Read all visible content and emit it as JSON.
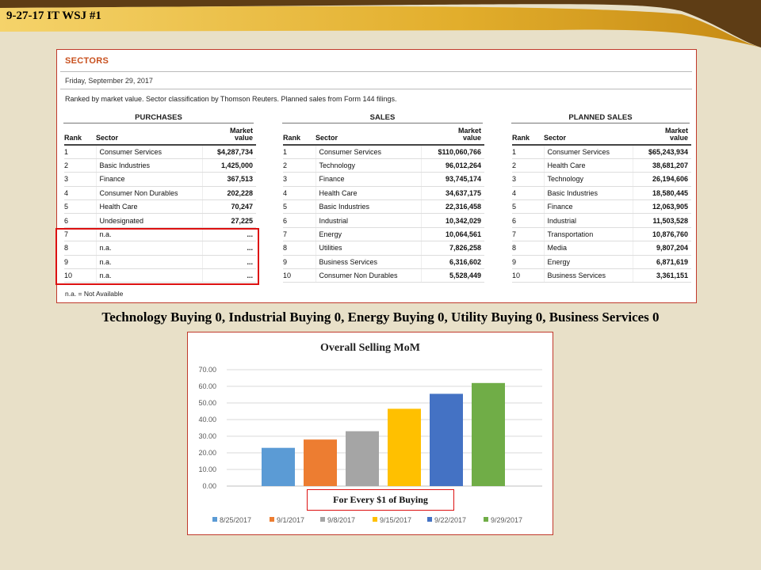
{
  "slide": {
    "title": "9-27-17 IT WSJ #1"
  },
  "sectors": {
    "heading": "SECTORS",
    "date": "Friday, September 29, 2017",
    "note": "Ranked by market value. Sector classification by Thomson Reuters. Planned sales from Form 144 filings.",
    "footnote": "n.a. = Not Available",
    "col_rank": "Rank",
    "col_sector": "Sector",
    "col_market": "Market",
    "col_value": "value",
    "purchases": {
      "title": "PURCHASES",
      "rows": [
        {
          "rank": "1",
          "sector": "Consumer Services",
          "value": "$4,287,734"
        },
        {
          "rank": "2",
          "sector": "Basic Industries",
          "value": "1,425,000"
        },
        {
          "rank": "3",
          "sector": "Finance",
          "value": "367,513"
        },
        {
          "rank": "4",
          "sector": "Consumer Non Durables",
          "value": "202,228"
        },
        {
          "rank": "5",
          "sector": "Health Care",
          "value": "70,247"
        },
        {
          "rank": "6",
          "sector": "Undesignated",
          "value": "27,225"
        },
        {
          "rank": "7",
          "sector": "n.a.",
          "value": "..."
        },
        {
          "rank": "8",
          "sector": "n.a.",
          "value": "..."
        },
        {
          "rank": "9",
          "sector": "n.a.",
          "value": "..."
        },
        {
          "rank": "10",
          "sector": "n.a.",
          "value": "..."
        }
      ]
    },
    "sales": {
      "title": "SALES",
      "rows": [
        {
          "rank": "1",
          "sector": "Consumer Services",
          "value": "$110,060,766"
        },
        {
          "rank": "2",
          "sector": "Technology",
          "value": "96,012,264"
        },
        {
          "rank": "3",
          "sector": "Finance",
          "value": "93,745,174"
        },
        {
          "rank": "4",
          "sector": "Health Care",
          "value": "34,637,175"
        },
        {
          "rank": "5",
          "sector": "Basic Industries",
          "value": "22,316,458"
        },
        {
          "rank": "6",
          "sector": "Industrial",
          "value": "10,342,029"
        },
        {
          "rank": "7",
          "sector": "Energy",
          "value": "10,064,561"
        },
        {
          "rank": "8",
          "sector": "Utilities",
          "value": "7,826,258"
        },
        {
          "rank": "9",
          "sector": "Business Services",
          "value": "6,316,602"
        },
        {
          "rank": "10",
          "sector": "Consumer Non Durables",
          "value": "5,528,449"
        }
      ]
    },
    "planned": {
      "title": "PLANNED SALES",
      "rows": [
        {
          "rank": "1",
          "sector": "Consumer Services",
          "value": "$65,243,934"
        },
        {
          "rank": "2",
          "sector": "Health Care",
          "value": "38,681,207"
        },
        {
          "rank": "3",
          "sector": "Technology",
          "value": "26,194,606"
        },
        {
          "rank": "4",
          "sector": "Basic Industries",
          "value": "18,580,445"
        },
        {
          "rank": "5",
          "sector": "Finance",
          "value": "12,063,905"
        },
        {
          "rank": "6",
          "sector": "Industrial",
          "value": "11,503,528"
        },
        {
          "rank": "7",
          "sector": "Transportation",
          "value": "10,876,760"
        },
        {
          "rank": "8",
          "sector": "Media",
          "value": "9,807,204"
        },
        {
          "rank": "9",
          "sector": "Energy",
          "value": "6,871,619"
        },
        {
          "rank": "10",
          "sector": "Business Services",
          "value": "3,361,151"
        }
      ]
    }
  },
  "caption": "Technology Buying 0, Industrial  Buying 0, Energy Buying 0, Utility  Buying 0, Business Services 0",
  "buying_label": "For Every $1 of Buying",
  "colors": {
    "highlight": "#dd1111",
    "band": "#6b4a1f",
    "band_gold": "#e0b030"
  },
  "chart_data": {
    "type": "bar",
    "title": "Overall Selling MoM",
    "xlabel": "",
    "ylabel": "",
    "ylim": [
      0,
      70
    ],
    "yticks": [
      "0.00",
      "10.00",
      "20.00",
      "30.00",
      "40.00",
      "50.00",
      "60.00",
      "70.00"
    ],
    "grid": true,
    "legend_position": "bottom",
    "series": [
      {
        "name": "8/25/2017",
        "value": 23,
        "color": "#5b9bd5"
      },
      {
        "name": "9/1/2017",
        "value": 28,
        "color": "#ed7d31"
      },
      {
        "name": "9/8/2017",
        "value": 33,
        "color": "#a5a5a5"
      },
      {
        "name": "9/15/2017",
        "value": 46.5,
        "color": "#ffc000"
      },
      {
        "name": "9/22/2017",
        "value": 55.5,
        "color": "#4472c4"
      },
      {
        "name": "9/29/2017",
        "value": 62,
        "color": "#70ad47"
      }
    ]
  }
}
